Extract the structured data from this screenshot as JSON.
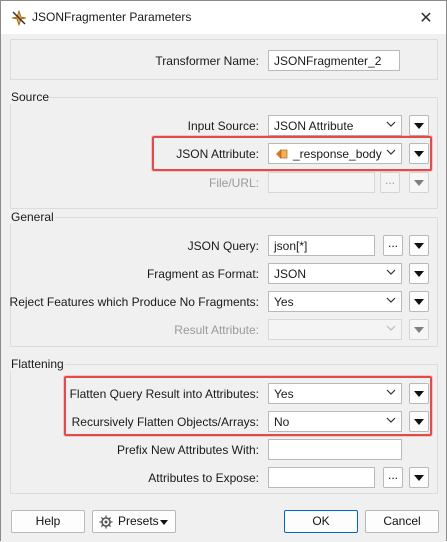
{
  "window": {
    "title": "JSONFragmenter Parameters",
    "close_glyph": "✕"
  },
  "top": {
    "transformer_name_label": "Transformer Name:",
    "transformer_name_value": "JSONFragmenter_2"
  },
  "source": {
    "title": "Source",
    "input_source_label": "Input Source:",
    "input_source_value": "JSON Attribute",
    "json_attribute_label": "JSON Attribute:",
    "json_attribute_value": "_response_body",
    "file_url_label": "File/URL:",
    "ellipsis": "..."
  },
  "general": {
    "title": "General",
    "json_query_label": "JSON Query:",
    "json_query_value": "json[*]",
    "fragment_format_label": "Fragment as Format:",
    "fragment_format_value": "JSON",
    "reject_label": "Reject Features which Produce No Fragments:",
    "reject_value": "Yes",
    "result_attr_label": "Result Attribute:",
    "ellipsis": "..."
  },
  "flattening": {
    "title": "Flattening",
    "flatten_label": "Flatten Query Result into Attributes:",
    "flatten_value": "Yes",
    "recursive_label": "Recursively Flatten Objects/Arrays:",
    "recursive_value": "No",
    "prefix_label": "Prefix New Attributes With:",
    "expose_label": "Attributes to Expose:",
    "ellipsis": "..."
  },
  "footer": {
    "help": "Help",
    "presets": "Presets",
    "ok": "OK",
    "cancel": "Cancel"
  },
  "colors": {
    "highlight": "#e04b4b",
    "primary_border": "#0067c0"
  }
}
